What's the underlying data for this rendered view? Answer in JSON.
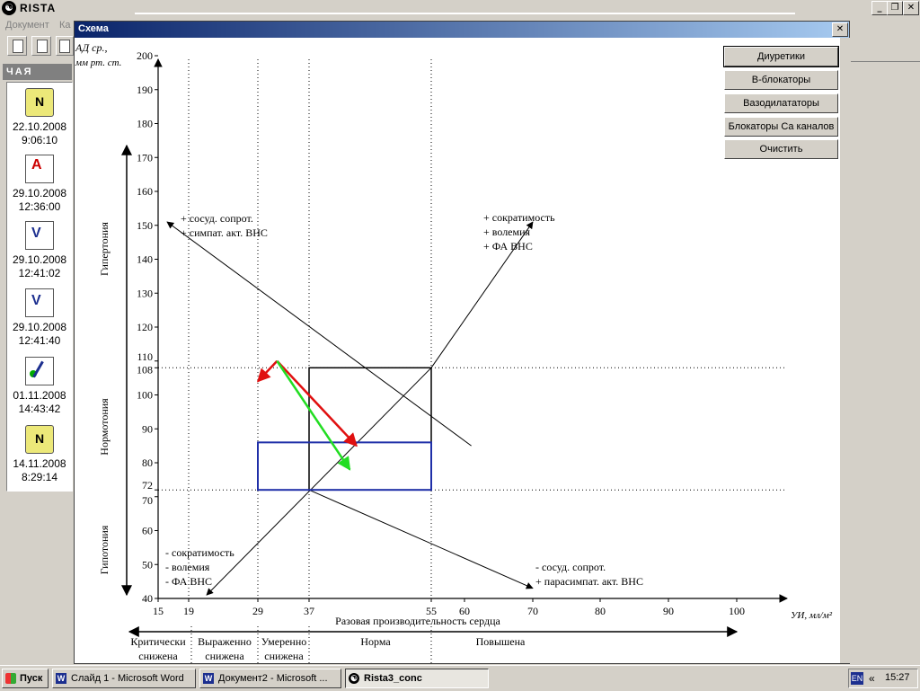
{
  "app": {
    "title": "RISTA",
    "menu": [
      "Документ",
      "Ка"
    ]
  },
  "left_panel": {
    "header": "ЧАЯ",
    "docs": [
      {
        "icon": "n-document-icon",
        "date": "22.10.2008",
        "time": "9:06:10"
      },
      {
        "icon": "pdf-document-icon",
        "date": "29.10.2008",
        "time": "12:36:00"
      },
      {
        "icon": "v-document-icon",
        "date": "29.10.2008",
        "time": "12:41:02"
      },
      {
        "icon": "v-document-icon",
        "date": "29.10.2008",
        "time": "12:41:40"
      },
      {
        "icon": "pen-document-icon",
        "date": "01.11.2008",
        "time": "14:43:42"
      },
      {
        "icon": "n-document-icon",
        "date": "14.11.2008",
        "time": "8:29:14"
      }
    ]
  },
  "dialog": {
    "title": "Схема",
    "buttons": [
      "Диуретики",
      "B-блокаторы",
      "Вазодилататоры",
      "Блокаторы Ca каналов",
      "Очистить"
    ]
  },
  "chart_data": {
    "type": "scatter",
    "ylabel": "АД ср., мм рт. ст.",
    "xlabel": "УИ, мл/м²",
    "x_axis_title": "Разовая производительность сердца",
    "y_ticks": [
      "200",
      "190",
      "180",
      "170",
      "160",
      "150",
      "140",
      "130",
      "120",
      "110",
      "108",
      "100",
      "90",
      "80",
      "72",
      "70",
      "60",
      "50",
      "40"
    ],
    "x_ticks": [
      "15",
      "19",
      "29",
      "37",
      "55",
      "60",
      "70",
      "80",
      "90",
      "100"
    ],
    "ylim": [
      40,
      200
    ],
    "xlim": [
      15,
      100
    ],
    "y_regions": [
      "Гипертония",
      "Нормотония",
      "Гипотония"
    ],
    "x_regions": [
      {
        "line1": "Критически",
        "line2": "снижена"
      },
      {
        "line1": "Выраженно",
        "line2": "снижена"
      },
      {
        "line1": "Умеренно",
        "line2": "снижена"
      },
      {
        "line1": "Норма",
        "line2": ""
      },
      {
        "line1": "Повышена",
        "line2": ""
      }
    ],
    "annotations": {
      "upper_left": [
        "+ сосуд. сопрот.",
        "+ симпат. акт. ВНС"
      ],
      "upper_right": [
        "+ сократимость",
        "+ волемия",
        "+ ФА ВНС"
      ],
      "lower_left": [
        "- сократимость",
        "- волемия",
        "- ФА ВНС"
      ],
      "lower_right": [
        "- сосуд. сопрот.",
        "+ парасимпат. акт. ВНС"
      ]
    },
    "norm_box": {
      "x": [
        37,
        55
      ],
      "y": [
        72,
        108
      ],
      "color": "#000000"
    },
    "patient_box": {
      "x": [
        29,
        55
      ],
      "y": [
        72,
        86
      ],
      "color": "#1f2fa8"
    },
    "vectors": [
      {
        "from": [
          32,
          110
        ],
        "to": [
          29,
          104
        ],
        "color": "#e01010"
      },
      {
        "from": [
          32,
          110
        ],
        "to": [
          44,
          85
        ],
        "color": "#e01010"
      },
      {
        "from": [
          32,
          110
        ],
        "to": [
          43,
          78
        ],
        "color": "#22dd22"
      }
    ],
    "colors": {
      "axes": "#000000",
      "gridline": "#000000"
    }
  },
  "taskbar": {
    "start": "Пуск",
    "tasks": [
      "Слайд 1 - Microsoft Word",
      "Документ2 - Microsoft ...",
      "Rista3_conc"
    ],
    "lang": "EN",
    "arrows": "«",
    "clock": "15:27"
  }
}
